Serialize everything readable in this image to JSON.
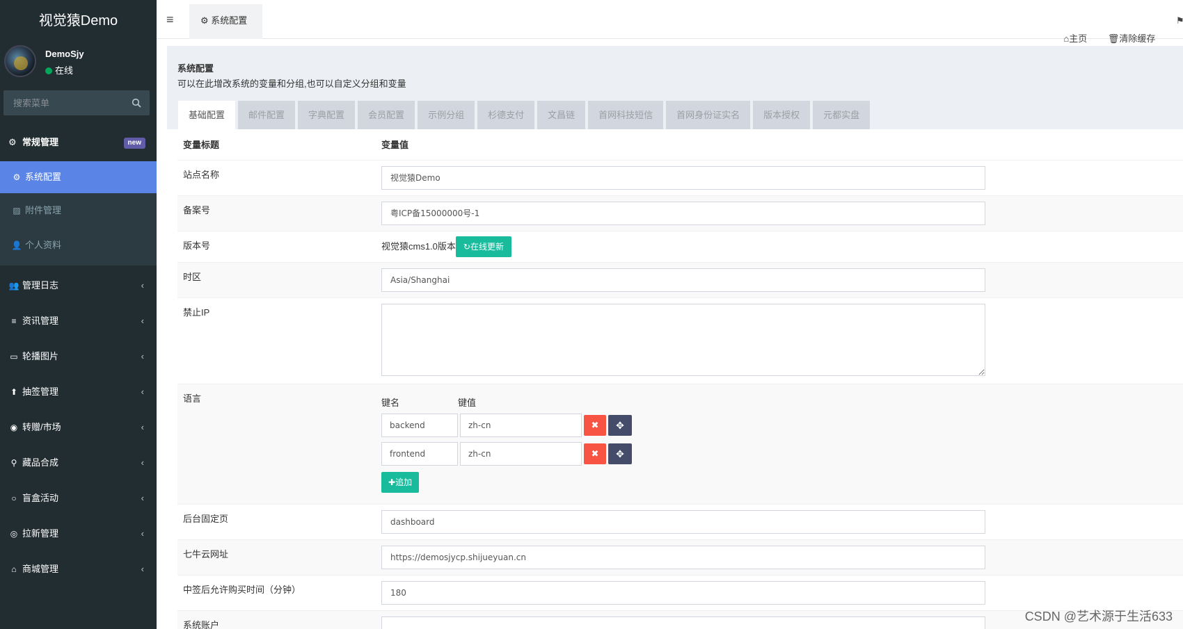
{
  "app": {
    "title": "视觉猿Demo"
  },
  "user": {
    "name": "DemoSjy",
    "status": "在线"
  },
  "search": {
    "placeholder": "搜索菜单"
  },
  "menu": {
    "header": {
      "label": "常规管理",
      "badge": "new"
    },
    "active": {
      "label": "系统配置"
    },
    "sub_items": [
      {
        "label": "附件管理",
        "icon": "image-file-icon"
      },
      {
        "label": "个人资料",
        "icon": "user-icon"
      }
    ],
    "items": [
      {
        "label": "管理日志",
        "icon": "users-icon"
      },
      {
        "label": "资讯管理",
        "icon": "list-icon"
      },
      {
        "label": "轮播图片",
        "icon": "card-icon"
      },
      {
        "label": "抽签管理",
        "icon": "arrow-circle-icon"
      },
      {
        "label": "转赠/市场",
        "icon": "compass-icon"
      },
      {
        "label": "藏品合成",
        "icon": "motorcycle-icon"
      },
      {
        "label": "盲盒活动",
        "icon": "circle-icon"
      },
      {
        "label": "拉新管理",
        "icon": "user-circle-icon"
      },
      {
        "label": "商城管理",
        "icon": "home-icon"
      }
    ]
  },
  "header": {
    "tab": "系统配置",
    "home": "主页",
    "clear_cache": "清除缓存"
  },
  "panel": {
    "title": "系统配置",
    "description": "可以在此增改系统的变量和分组,也可以自定义分组和变量"
  },
  "tabs": [
    "基础配置",
    "邮件配置",
    "字典配置",
    "会员配置",
    "示例分组",
    "杉德支付",
    "文昌链",
    "首网科技短信",
    "首网身份证实名",
    "版本授权",
    "元都实盘"
  ],
  "table": {
    "col_title": "变量标题",
    "col_value": "变量值",
    "site_name": {
      "label": "站点名称",
      "value": "视觉猿Demo"
    },
    "beian": {
      "label": "备案号",
      "value": "粤ICP备15000000号-1"
    },
    "version": {
      "label": "版本号",
      "value": "视觉猿cms1.0版本",
      "button": "在线更新"
    },
    "timezone": {
      "label": "时区",
      "value": "Asia/Shanghai"
    },
    "forbidden_ip": {
      "label": "禁止IP",
      "value": ""
    },
    "language": {
      "label": "语言",
      "key_header": "键名",
      "value_header": "键值",
      "rows": [
        {
          "key": "backend",
          "value": "zh-cn"
        },
        {
          "key": "frontend",
          "value": "zh-cn"
        }
      ],
      "add_button": "追加"
    },
    "fixed_page": {
      "label": "后台固定页",
      "value": "dashboard"
    },
    "qiniu_url": {
      "label": "七牛云网址",
      "value": "https://demosjycp.shijueyuan.cn"
    },
    "buy_time": {
      "label": "中签后允许购买时间（分钟）",
      "value": "180"
    },
    "next_row": {
      "label": "系统账户"
    }
  },
  "watermark": "CSDN @艺术源于生活633",
  "colors": {
    "sidebar_bg": "#222d32",
    "active_menu": "#5a84e5",
    "success": "#18bc9c",
    "danger": "#f75444",
    "badge": "#605ca8"
  }
}
